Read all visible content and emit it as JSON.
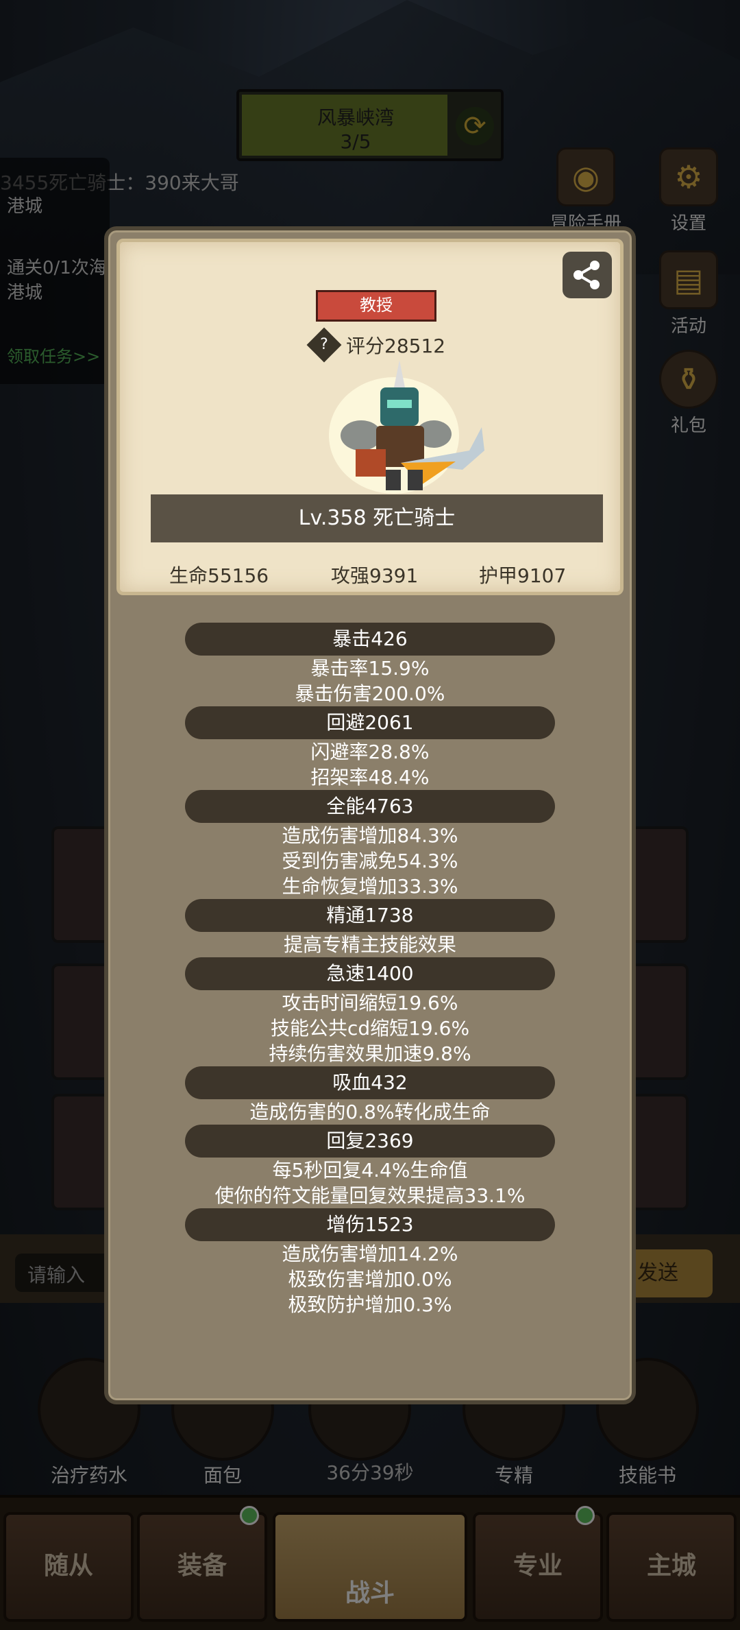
{
  "stage": {
    "name": "风暴峡湾",
    "progress": "3/5",
    "refresh_icon": "refresh-icon"
  },
  "announcement": "3455死亡骑士：390来大哥",
  "quest": {
    "line1": "港城",
    "line2": "通关0/1次海",
    "line3": "港城",
    "link": "领取任务>>"
  },
  "side_menu": [
    {
      "label": "冒险手册",
      "icon": "book-icon"
    },
    {
      "label": "设置",
      "icon": "gear-icon"
    },
    {
      "label": "活动",
      "icon": "scroll-icon"
    },
    {
      "label": "礼包",
      "icon": "giftbag-icon"
    }
  ],
  "chat": {
    "placeholder": "请输入",
    "send": "发送"
  },
  "items": [
    "治疗药水",
    "面包",
    "",
    "专精",
    "技能书"
  ],
  "timer": "36分39秒",
  "nav": [
    "随从",
    "装备",
    "战斗",
    "专业",
    "主城"
  ],
  "modal": {
    "title": "教授",
    "score": "评分28512",
    "name": "Lv.358 死亡骑士",
    "hp": "生命55156",
    "atk": "攻强9391",
    "armor": "护甲9107"
  },
  "attributes": [
    {
      "header": "暴击426",
      "lines": [
        "暴击率15.9%",
        "暴击伤害200.0%"
      ]
    },
    {
      "header": "回避2061",
      "lines": [
        "闪避率28.8%",
        "招架率48.4%"
      ]
    },
    {
      "header": "全能4763",
      "lines": [
        "造成伤害增加84.3%",
        "受到伤害减免54.3%",
        "生命恢复增加33.3%"
      ]
    },
    {
      "header": "精通1738",
      "lines": [
        "提高专精主技能效果"
      ]
    },
    {
      "header": "急速1400",
      "lines": [
        "攻击时间缩短19.6%",
        "技能公共cd缩短19.6%",
        "持续伤害效果加速9.8%"
      ]
    },
    {
      "header": "吸血432",
      "lines": [
        "造成伤害的0.8%转化成生命"
      ]
    },
    {
      "header": "回复2369",
      "lines": [
        "每5秒回复4.4%生命值",
        "使你的符文能量回复效果提高33.1%"
      ]
    },
    {
      "header": "增伤1523",
      "lines": [
        "造成伤害增加14.2%",
        "极致伤害增加0.0%",
        "极致防护增加0.3%"
      ]
    }
  ],
  "colors": {
    "title_badge": "#c94a3c",
    "card_bg": "#efe3c7",
    "modal_bg": "#8b7f6a",
    "pill_bg": "#3d352a"
  }
}
